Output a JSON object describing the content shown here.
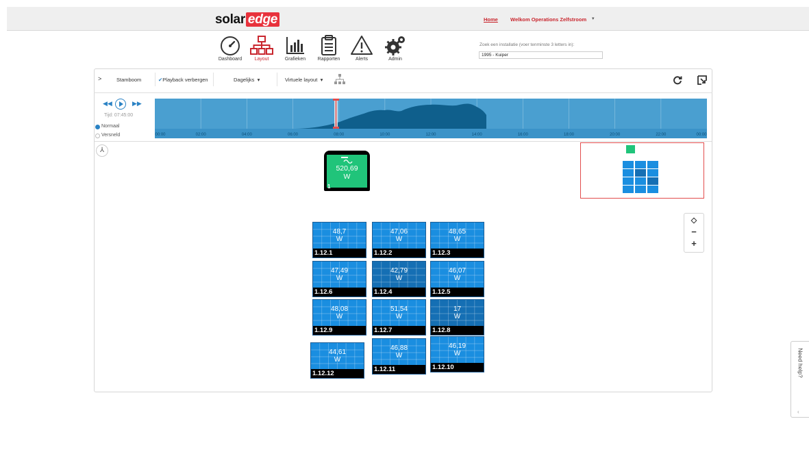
{
  "header": {
    "logo_left": "solar",
    "logo_right": "edge",
    "home_link": "Home",
    "welcome": "Welkom Operations Zelfstroom",
    "welcome_caret": "▾"
  },
  "nav": [
    {
      "label": "Dashboard",
      "icon": "gauge-icon",
      "active": false
    },
    {
      "label": "Layout",
      "icon": "sitemap-icon",
      "active": true
    },
    {
      "label": "Grafieken",
      "icon": "bar-chart-icon",
      "active": false
    },
    {
      "label": "Rapporten",
      "icon": "clipboard-icon",
      "active": false
    },
    {
      "label": "Alerts",
      "icon": "warning-icon",
      "active": false
    },
    {
      "label": "Admin",
      "icon": "gears-icon",
      "active": false
    }
  ],
  "search": {
    "label": "Zoek een installatie (voer tenminste 3 letters in):",
    "value": "1995 - Kuiper"
  },
  "toolbar": {
    "chevron": ">",
    "stamboom": "Stamboom",
    "playback": "Playback verbergen",
    "period": "Dagelijks",
    "layout": "Virtuele layout",
    "caret": "▾"
  },
  "playback": {
    "rewind": "◀◀",
    "forward": "▶▶",
    "time": "Tijd: 07:45:00",
    "speed_options": [
      {
        "label": "Normaal",
        "selected": true
      },
      {
        "label": "Versneld",
        "selected": false
      }
    ],
    "hours": [
      "00:00",
      "02:00",
      "04:00",
      "06:00",
      "08:00",
      "10:00",
      "12:00",
      "14:00",
      "16:00",
      "18:00",
      "20:00",
      "22:00",
      "00:00"
    ],
    "cursor_hour": 7.75
  },
  "inverter": {
    "power": "520,69",
    "unit": "W",
    "id": "1",
    "color": "#20c47a"
  },
  "modules": [
    {
      "power": "48,7",
      "unit": "W",
      "id": "1.12.1",
      "shade": "light"
    },
    {
      "power": "47,06",
      "unit": "W",
      "id": "1.12.2",
      "shade": "light"
    },
    {
      "power": "48,65",
      "unit": "W",
      "id": "1.12.3",
      "shade": "light"
    },
    {
      "power": "47,49",
      "unit": "W",
      "id": "1.12.6",
      "shade": "light"
    },
    {
      "power": "42,79",
      "unit": "W",
      "id": "1.12.4",
      "shade": "dark"
    },
    {
      "power": "46,07",
      "unit": "W",
      "id": "1.12.5",
      "shade": "light"
    },
    {
      "power": "48,08",
      "unit": "W",
      "id": "1.12.9",
      "shade": "light"
    },
    {
      "power": "51,54",
      "unit": "W",
      "id": "1.12.7",
      "shade": "light"
    },
    {
      "power": "17",
      "unit": "W",
      "id": "1.12.8",
      "shade": "dark"
    },
    {
      "power": "44,61",
      "unit": "W",
      "id": "1.12.12",
      "shade": "light"
    },
    {
      "power": "46,88",
      "unit": "W",
      "id": "1.12.11",
      "shade": "light"
    },
    {
      "power": "46,19",
      "unit": "W",
      "id": "1.12.10",
      "shade": "light"
    }
  ],
  "zoom": {
    "center": "◇",
    "minus": "−",
    "plus": "+"
  },
  "need_help": {
    "label": "Need help?",
    "chevron": "‹"
  },
  "colors": {
    "brand": "#e8323c",
    "module_light": "#1a8ee0",
    "module_dark": "#156fb4",
    "timeline": "#1a7ab0"
  }
}
